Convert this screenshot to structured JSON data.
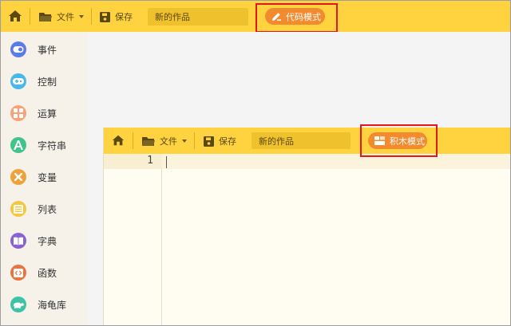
{
  "toolbar": {
    "file_label": "文件",
    "save_label": "保存",
    "project_name": "新的作品",
    "mode_button": "代码模式"
  },
  "sidebar": {
    "items": [
      {
        "label": "事件",
        "color": "#5b7be8",
        "icon": "toggle-icon"
      },
      {
        "label": "控制",
        "color": "#48b8e8",
        "icon": "gamepad-icon"
      },
      {
        "label": "运算",
        "color": "#f4a37a",
        "icon": "calculator-icon"
      },
      {
        "label": "字符串",
        "color": "#3fc48b",
        "icon": "letter-a-icon"
      },
      {
        "label": "变量",
        "color": "#f0a23a",
        "icon": "x-variable-icon"
      },
      {
        "label": "列表",
        "color": "#f6c73c",
        "icon": "list-icon"
      },
      {
        "label": "字典",
        "color": "#8a63d2",
        "icon": "book-icon"
      },
      {
        "label": "函数",
        "color": "#e9743f",
        "icon": "code-icon"
      },
      {
        "label": "海龟库",
        "color": "#3ec3a6",
        "icon": "turtle-icon"
      }
    ]
  },
  "inner": {
    "file_label": "文件",
    "save_label": "保存",
    "project_name": "新的作品",
    "mode_button": "积木模式",
    "line_number": "1"
  },
  "colors": {
    "toolbar": "#ffd23f",
    "mode_button": "#f28a2e",
    "highlight_box": "#e3181f"
  }
}
